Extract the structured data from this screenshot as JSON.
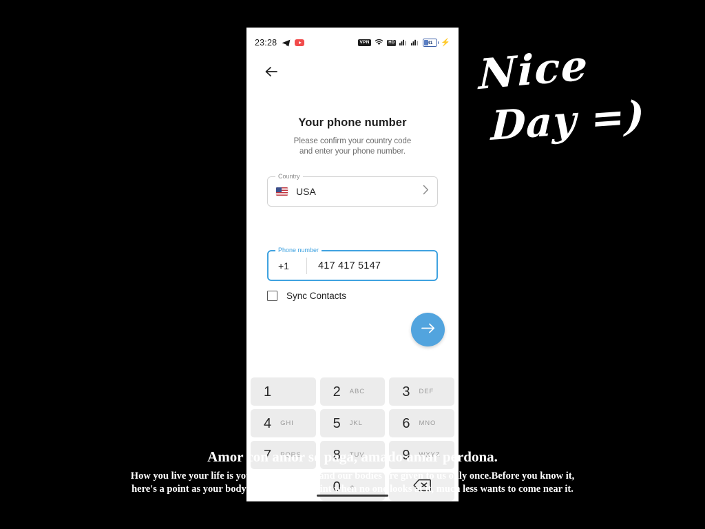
{
  "status_bar": {
    "time": "23:28",
    "left_icons": [
      "telegram-icon",
      "youtube-icon"
    ],
    "vpn_label": "VPN",
    "wifi_icon": "wifi-icon",
    "hd_label": "HD",
    "signal_icon_1": "signal-bars-icon",
    "signal_icon_2": "signal-bars-icon",
    "battery_percent": "41",
    "charging_icon": "lightning-bolt-icon"
  },
  "nav": {
    "back_icon": "back-arrow-icon"
  },
  "screen": {
    "title": "Your phone number",
    "subtitle_line1": "Please confirm your country code",
    "subtitle_line2": "and enter your phone number."
  },
  "country_field": {
    "legend": "Country",
    "value": "USA",
    "flag_icon": "usa-flag-icon",
    "chevron_icon": "chevron-right-icon"
  },
  "phone_field": {
    "legend": "Phone number",
    "country_code": "+1",
    "value": "417 417 5147",
    "placeholder": "Phone number",
    "focus_color": "#3fa2e0"
  },
  "sync_contacts": {
    "label": "Sync Contacts",
    "checked": false
  },
  "fab": {
    "icon": "arrow-right-icon",
    "color": "#52a4de"
  },
  "keypad": {
    "keys": [
      {
        "digit": "1",
        "letters": ""
      },
      {
        "digit": "2",
        "letters": "ABC"
      },
      {
        "digit": "3",
        "letters": "DEF"
      },
      {
        "digit": "4",
        "letters": "GHI"
      },
      {
        "digit": "5",
        "letters": "JKL"
      },
      {
        "digit": "6",
        "letters": "MNO"
      },
      {
        "digit": "7",
        "letters": "PQRS"
      },
      {
        "digit": "8",
        "letters": "TUV"
      },
      {
        "digit": "9",
        "letters": "WXYZ"
      }
    ],
    "zero_key": {
      "digit": "0",
      "letters": "+"
    },
    "backspace_icon": "backspace-icon"
  },
  "overlay": {
    "handwriting_line1": "Nice",
    "handwriting_line2": "Day =)",
    "caption_headline": "Amor con amor se paga, amado amar perdona.",
    "caption_body": "How you live your life is your own business, and our bodies are given to us only once.Before you know it,  here's a point as your body there comes a point when no one looks at it,  much less wants to come near it."
  }
}
